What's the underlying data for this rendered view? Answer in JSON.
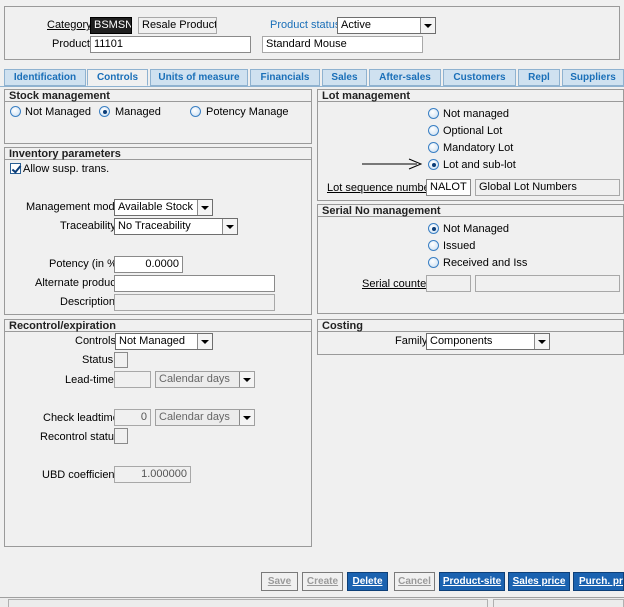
{
  "header": {
    "category_label": "Category",
    "category_code": "BSMSN",
    "category_name": "Resale Product",
    "status_label": "Product status",
    "status_value": "Active",
    "product_label": "Product",
    "product_code": "11101",
    "product_name": "Standard Mouse"
  },
  "tabs": [
    "Identification",
    "Controls",
    "Units of measure",
    "Financials",
    "Sales",
    "After-sales",
    "Customers",
    "Repl",
    "Suppliers"
  ],
  "stock": {
    "title": "Stock management",
    "options": [
      "Not Managed",
      "Managed",
      "Potency Manage"
    ],
    "selected": "Managed"
  },
  "inventory": {
    "title": "Inventory parameters",
    "allow_label": "Allow susp. trans.",
    "mgmt_mode_label": "Management mode",
    "mgmt_mode_value": "Available Stock",
    "traceability_label": "Traceability",
    "traceability_value": "No Traceability",
    "potency_label": "Potency (in %)",
    "potency_value": "0.0000",
    "alt_product_label": "Alternate product",
    "alt_product_value": "",
    "description_label": "Description",
    "description_value": ""
  },
  "recontrol": {
    "title": "Recontrol/expiration",
    "controls_label": "Controls",
    "controls_value": "Not Managed",
    "status_label": "Status",
    "leadtime_label": "Lead-time",
    "leadtime_unit": "Calendar days",
    "check_leadtime_label": "Check leadtime",
    "check_leadtime_value": "0",
    "check_leadtime_unit": "Calendar days",
    "recontrol_status_label": "Recontrol status",
    "ubd_label": "UBD coefficient",
    "ubd_value": "1.000000"
  },
  "lot": {
    "title": "Lot management",
    "options": [
      "Not managed",
      "Optional Lot",
      "Mandatory Lot",
      "Lot and sub-lot"
    ],
    "selected": "Lot and sub-lot",
    "sequence_label": "Lot sequence number",
    "sequence_code": "NALOT",
    "sequence_name": "Global Lot Numbers"
  },
  "serial": {
    "title": "Serial No management",
    "options": [
      "Not Managed",
      "Issued",
      "Received and Iss"
    ],
    "selected": "Not Managed",
    "counter_label": "Serial counter"
  },
  "costing": {
    "title": "Costing",
    "family_label": "Family",
    "family_value": "Components"
  },
  "buttons": [
    "Save",
    "Create",
    "Delete",
    "Cancel",
    "Product-site",
    "Sales price",
    "Purch. pric"
  ],
  "colors": {
    "tab_text": "#1a6fb8",
    "primary_button": "#1a62b0",
    "link_label": "#1a6fb8"
  }
}
